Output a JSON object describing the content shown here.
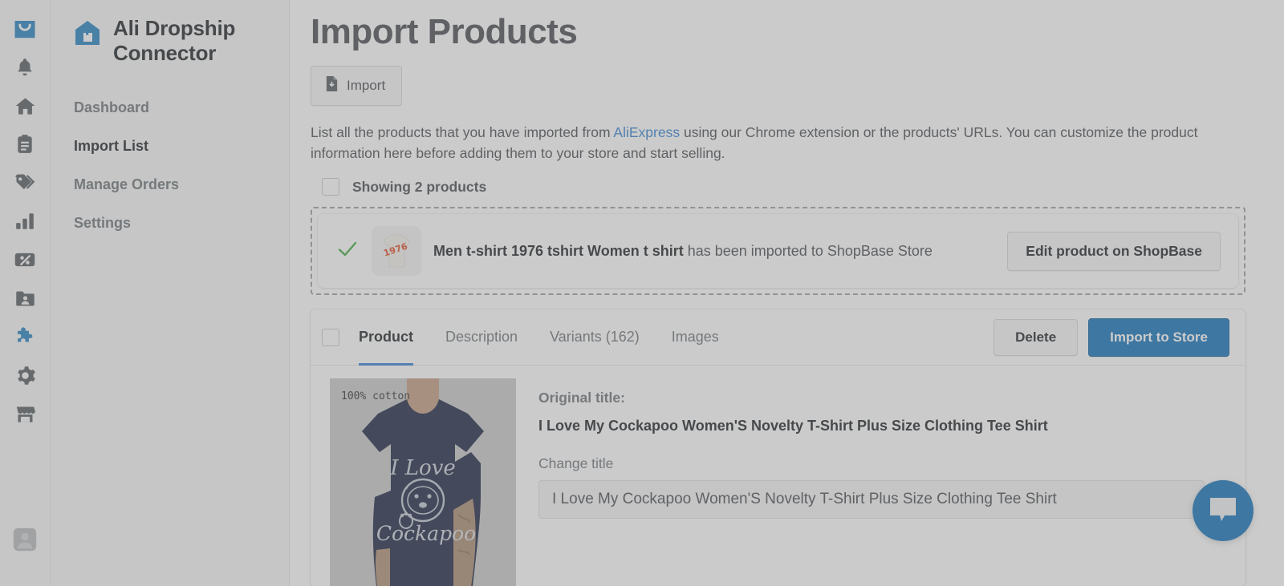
{
  "brand": {
    "title": "Ali Dropship Connector",
    "logo_icon": "store-box-icon"
  },
  "rail": {
    "items": [
      {
        "name": "shopping-bag-icon",
        "active": true
      },
      {
        "name": "bell-icon",
        "active": false
      },
      {
        "name": "home-icon",
        "active": false
      },
      {
        "name": "clipboard-icon",
        "active": false
      },
      {
        "name": "tags-icon",
        "active": false
      },
      {
        "name": "bar-chart-icon",
        "active": false
      },
      {
        "name": "discount-percent-icon",
        "active": false
      },
      {
        "name": "folder-user-icon",
        "active": false
      },
      {
        "name": "puzzle-piece-icon",
        "active": true
      },
      {
        "name": "gear-icon",
        "active": false
      },
      {
        "name": "storefront-icon",
        "active": false
      }
    ],
    "bottom": {
      "name": "user-avatar-icon"
    }
  },
  "sidebar": {
    "items": [
      {
        "label": "Dashboard",
        "active": false
      },
      {
        "label": "Import List",
        "active": true
      },
      {
        "label": "Manage Orders",
        "active": false
      },
      {
        "label": "Settings",
        "active": false
      }
    ]
  },
  "page": {
    "title": "Import Products",
    "import_button": "Import",
    "description_part1": "List all the products that you have imported from ",
    "description_link": "AliExpress",
    "description_part2": " using our Chrome extension or the products' URLs. You can customize the product information here before adding them to your store and start selling.",
    "showing_text": "Showing 2 products"
  },
  "notification": {
    "product_name": "Men t-shirt 1976 tshirt Women t shirt",
    "message": " has been imported to ShopBase Store",
    "edit_button": "Edit product on ShopBase",
    "status_icon": "check-icon",
    "thumbnail_alt": "1976 t-shirt thumbnail"
  },
  "product": {
    "tabs": [
      {
        "label": "Product",
        "active": true
      },
      {
        "label": "Description",
        "active": false
      },
      {
        "label": "Variants (162)",
        "active": false
      },
      {
        "label": "Images",
        "active": false
      }
    ],
    "delete_button": "Delete",
    "import_button": "Import to Store",
    "original_title_label": "Original title:",
    "original_title": "I Love My Cockapoo Women'S Novelty T-Shirt Plus Size Clothing Tee Shirt",
    "change_title_label": "Change title",
    "change_title_value": "I Love My Cockapoo Women'S Novelty T-Shirt Plus Size Clothing Tee Shirt",
    "change_title_placeholder": "Enter product title",
    "photo_overlay_text": "100% cotton",
    "photo_design_top": "I Love",
    "photo_design_bottom": "Cockapoo"
  },
  "chat": {
    "icon": "chat-bubble-icon"
  },
  "colors": {
    "accent_blue": "#0d6fb8",
    "link_blue": "#2f7fd1",
    "success_green": "#3aa93a",
    "sidebar_bg": "#f6f6f7",
    "text_dark": "#1b1f24",
    "text_muted": "#6c7278"
  }
}
